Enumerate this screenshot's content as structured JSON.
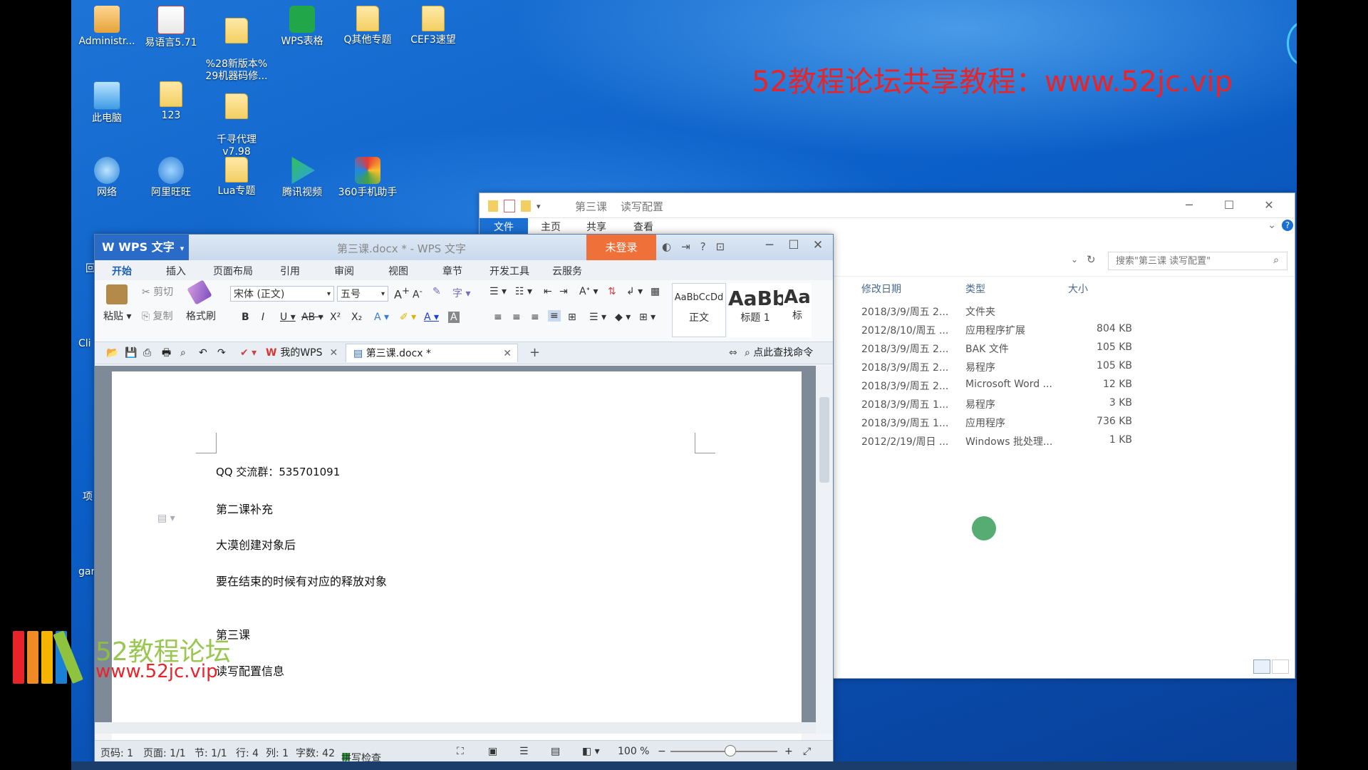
{
  "desktop": {
    "icons": [
      {
        "label": "Administr...",
        "icon": "user-folder-icon"
      },
      {
        "label": "易语言5.71",
        "icon": "app-icon"
      },
      {
        "label": "%28新版本%\n29机器码修...",
        "icon": "folder-icon"
      },
      {
        "label": "WPS表格",
        "icon": "wps-sheet-icon"
      },
      {
        "label": "Q其他专题",
        "icon": "folder-icon"
      },
      {
        "label": "CEF3速望",
        "icon": "folder-icon"
      },
      {
        "label": "此电脑",
        "icon": "computer-icon"
      },
      {
        "label": "123",
        "icon": "folder-icon"
      },
      {
        "label": "千寻代理\nv7.98",
        "icon": "folder-icon"
      },
      {
        "label": "网络",
        "icon": "network-icon"
      },
      {
        "label": "阿里旺旺",
        "icon": "aliwangwang-icon"
      },
      {
        "label": "Lua专题",
        "icon": "folder-icon"
      },
      {
        "label": "腾讯视频",
        "icon": "tencent-video-icon"
      },
      {
        "label": "360手机助手",
        "icon": "360-icon"
      }
    ],
    "edge_labels": [
      "回",
      "Cli",
      "项",
      "gar"
    ],
    "watermark_top": "52教程论坛共享教程：www.52jc.vip",
    "logo_text1": "52教程论坛",
    "logo_text2": "www.52jc.vip"
  },
  "explorer": {
    "title_path": "第三课",
    "title_sub": "读写配置",
    "tabs": [
      "文件",
      "主页",
      "共享",
      "查看"
    ],
    "search_placeholder": "搜索\"第三课  读写配置\"",
    "columns": [
      "修改日期",
      "类型",
      "大小"
    ],
    "rows": [
      {
        "date": "2018/3/9/周五 2...",
        "type": "文件夹",
        "size": ""
      },
      {
        "date": "2012/8/10/周五 ...",
        "type": "应用程序扩展",
        "size": "804 KB"
      },
      {
        "date": "2018/3/9/周五 2...",
        "type": "BAK 文件",
        "size": "105 KB"
      },
      {
        "date": "2018/3/9/周五 2...",
        "type": "易程序",
        "size": "105 KB"
      },
      {
        "date": "2018/3/9/周五 2...",
        "type": "Microsoft Word ...",
        "size": "12 KB"
      },
      {
        "date": "2018/3/9/周五 1...",
        "type": "易程序",
        "size": "3 KB"
      },
      {
        "date": "2018/3/9/周五 1...",
        "type": "应用程序",
        "size": "736 KB"
      },
      {
        "date": "2012/2/19/周日 ...",
        "type": "Windows 批处理...",
        "size": "1 KB"
      }
    ]
  },
  "wps": {
    "app_name": "WPS 文字",
    "doc_title": "第三课.docx * - WPS 文字",
    "login_label": "未登录",
    "ribbon_tabs": [
      "开始",
      "插入",
      "页面布局",
      "引用",
      "审阅",
      "视图",
      "章节",
      "开发工具",
      "云服务"
    ],
    "paste_label": "粘贴",
    "cut_label": "剪切",
    "copy_label": "复制",
    "format_painter_label": "格式刷",
    "font_name": "宋体 (正文)",
    "font_size": "五号",
    "style_normal_preview": "AaBbCcDd",
    "style_normal_label": "正文",
    "style_h1_preview": "AaBb",
    "style_h1_label": "标题 1",
    "style_more_preview": "Aa",
    "style_more_label": "标",
    "tab_mywps": "我的WPS",
    "tab_doc": "第三课.docx *",
    "find_command": "点此查找命令",
    "paragraphs": [
      "QQ 交流群：535701091",
      "第二课补充",
      "大漠创建对象后",
      "要在结束的时候有对应的释放对象",
      "第三课",
      "读写配置信息"
    ],
    "status": {
      "page_no": "页码: 1",
      "pages": "页面: 1/1",
      "section": "节: 1/1",
      "row": "行: 4",
      "col": "列: 1",
      "words": "字数: 42",
      "spell": "拼写检查",
      "zoom": "100 %"
    }
  }
}
